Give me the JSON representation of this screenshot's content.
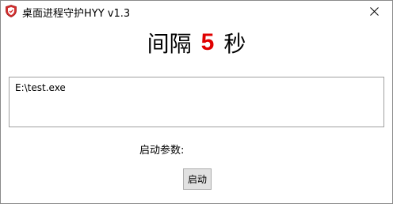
{
  "window": {
    "title": "桌面进程守护HYY v1.3",
    "icons": {
      "app": "shield-icon",
      "close": "close-icon"
    }
  },
  "interval": {
    "prefix": "间隔",
    "value": "5",
    "suffix": "秒",
    "value_color": "#e00000"
  },
  "process": {
    "path": "E:\\test.exe"
  },
  "params": {
    "label": "启动参数:"
  },
  "actions": {
    "start_label": "启动"
  }
}
